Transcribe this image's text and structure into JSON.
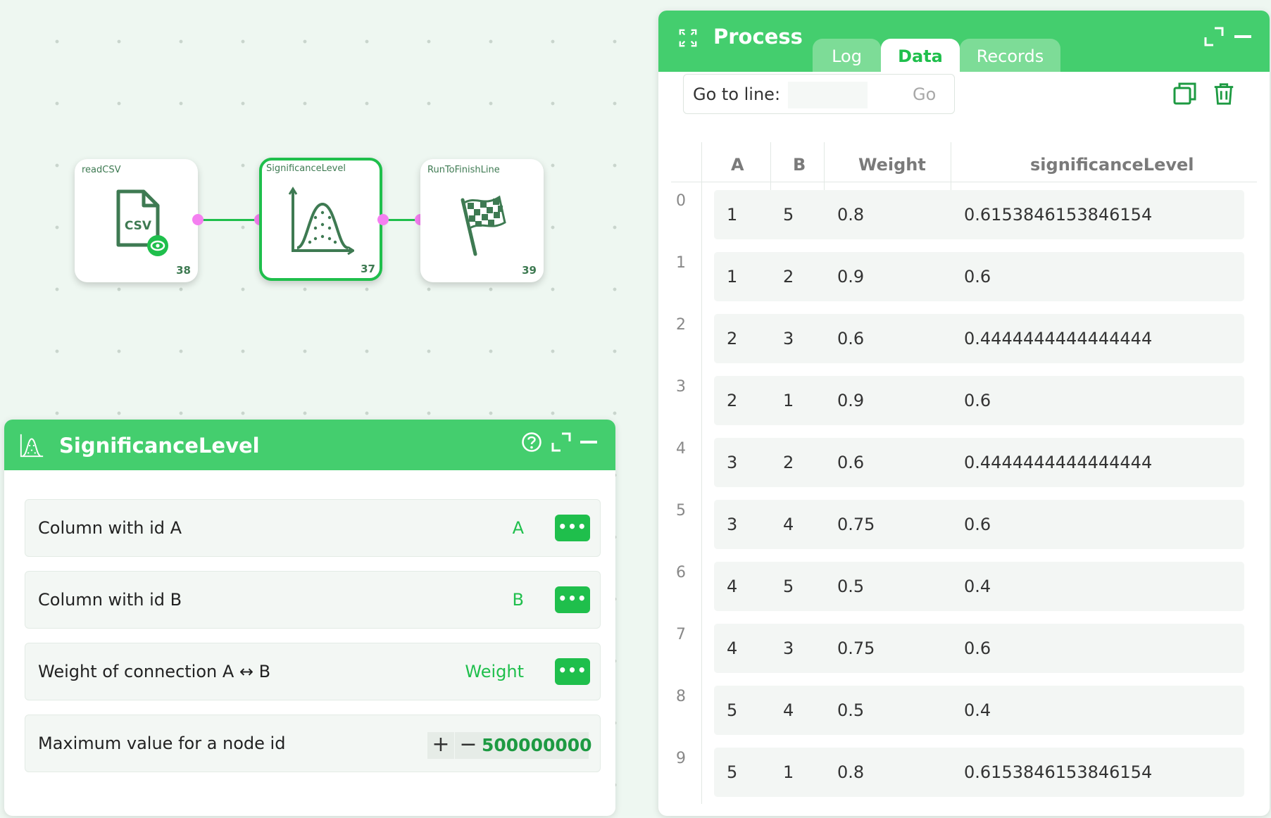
{
  "canvas": {
    "nodes": [
      {
        "title": "readCSV",
        "id": "38",
        "icon": "csv-file-icon",
        "icon_text": "CSV"
      },
      {
        "title": "SignificanceLevel",
        "id": "37",
        "icon": "distribution-chart-icon"
      },
      {
        "title": "RunToFinishLine",
        "id": "39",
        "icon": "checkered-flag-icon"
      }
    ]
  },
  "settings_panel": {
    "title": "SignificanceLevel",
    "icon": "distribution-chart-icon",
    "rows": [
      {
        "label": "Column with id A",
        "value": "A",
        "button": "•••"
      },
      {
        "label": "Column with id B",
        "value": "B",
        "button": "•••"
      },
      {
        "label": "Weight of connection A ↔ B",
        "value": "Weight",
        "button": "•••"
      }
    ],
    "max_row": {
      "label": "Maximum value for a node id",
      "plus": "+",
      "minus": "−",
      "value": "500000000"
    }
  },
  "process_panel": {
    "title": "Process",
    "tabs": [
      {
        "label": "Log",
        "active": false
      },
      {
        "label": "Data",
        "active": true
      },
      {
        "label": "Records",
        "active": false
      }
    ],
    "goto_label": "Go to line:",
    "goto_value": "",
    "goto_button": "Go",
    "columns": [
      "A",
      "B",
      "Weight",
      "significanceLevel"
    ],
    "row_indexes": [
      "0",
      "1",
      "2",
      "3",
      "4",
      "5",
      "6",
      "7",
      "8",
      "9"
    ],
    "rows": [
      [
        "1",
        "5",
        "0.8",
        "0.6153846153846154"
      ],
      [
        "1",
        "2",
        "0.9",
        "0.6"
      ],
      [
        "2",
        "3",
        "0.6",
        "0.4444444444444444"
      ],
      [
        "2",
        "1",
        "0.9",
        "0.6"
      ],
      [
        "3",
        "2",
        "0.6",
        "0.4444444444444444"
      ],
      [
        "3",
        "4",
        "0.75",
        "0.6"
      ],
      [
        "4",
        "5",
        "0.5",
        "0.4"
      ],
      [
        "4",
        "3",
        "0.75",
        "0.6"
      ],
      [
        "5",
        "4",
        "0.5",
        "0.4"
      ],
      [
        "5",
        "1",
        "0.8",
        "0.6153846153846154"
      ]
    ]
  },
  "colors": {
    "accent": "#1fbf4c",
    "header": "#44ce6e",
    "port": "#f47ff0",
    "background": "#eef7f1"
  }
}
